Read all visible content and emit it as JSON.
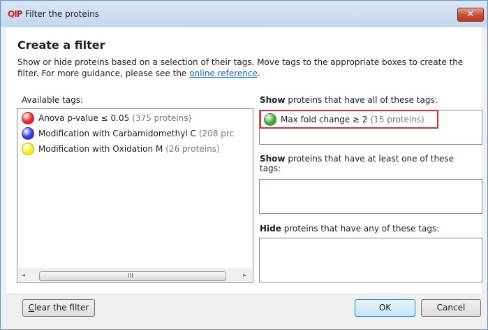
{
  "window": {
    "app_icon_text": "QIP",
    "title": "Filter the proteins",
    "close_glyph": "✕"
  },
  "header": {
    "title": "Create a filter",
    "description": "Show or hide proteins based on a selection of their tags. Move tags to the appropriate boxes to create the filter. For more guidance, please see the ",
    "link_text": "online reference",
    "description_end": "."
  },
  "available": {
    "label": "Available tags:",
    "tags": [
      {
        "name": "Anova p-value ≤ 0.05",
        "count": "(375 proteins)",
        "color": "#e8252a"
      },
      {
        "name": "Modification with Carbamidomethyl C",
        "count": "(208 prc",
        "color": "#2f35e0"
      },
      {
        "name": "Modification with Oxidation M",
        "count": "(26 proteins)",
        "color": "#f2ee1c"
      }
    ],
    "scroll_left": "◄",
    "scroll_right": "►",
    "scroll_grip": "III"
  },
  "show_all": {
    "label_bold": "Show",
    "label_rest": " proteins that have all of these tags:",
    "tags": [
      {
        "name": "Max fold change ≥ 2",
        "count": "(15 proteins)",
        "color": "#3daa3a"
      }
    ]
  },
  "show_any": {
    "label_bold": "Show",
    "label_rest": " proteins that have at least one of these tags:"
  },
  "hide_any": {
    "label_bold": "Hide",
    "label_rest": " proteins that have any of these tags:"
  },
  "footer": {
    "clear_label": "Clear the filter",
    "ok_label": "OK",
    "cancel_label": "Cancel"
  }
}
